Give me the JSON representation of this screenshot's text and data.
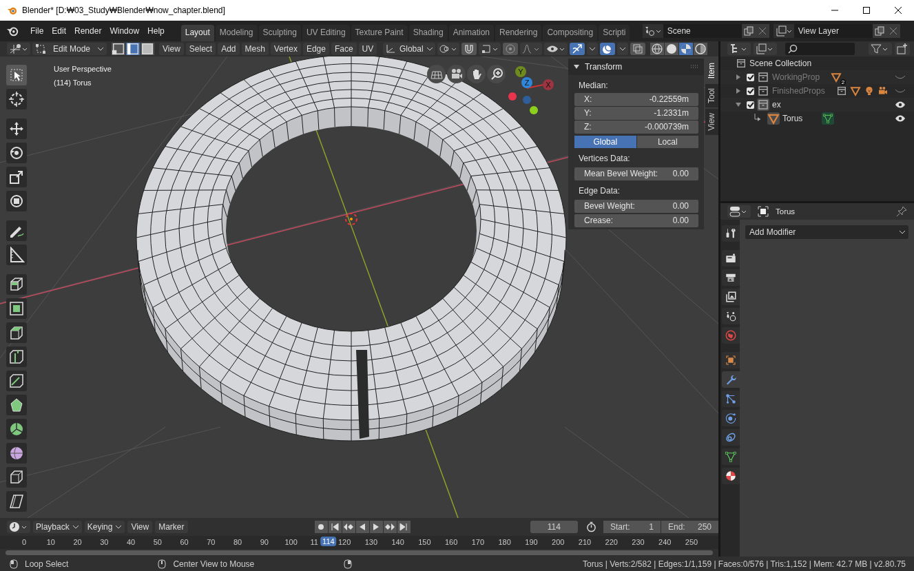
{
  "title_bar": {
    "title": "Blender* [D:₩03_Study₩Blender₩now_chapter.blend]"
  },
  "menu": [
    "File",
    "Edit",
    "Render",
    "Window",
    "Help"
  ],
  "workspace_tabs": [
    {
      "label": "Layout",
      "selected": true
    },
    {
      "label": "Modeling",
      "selected": false
    },
    {
      "label": "Sculpting",
      "selected": false
    },
    {
      "label": "UV Editing",
      "selected": false
    },
    {
      "label": "Texture Paint",
      "selected": false
    },
    {
      "label": "Shading",
      "selected": false
    },
    {
      "label": "Animation",
      "selected": false
    },
    {
      "label": "Rendering",
      "selected": false
    },
    {
      "label": "Compositing",
      "selected": false
    },
    {
      "label": "Scripti",
      "selected": false
    }
  ],
  "scene": {
    "name": "Scene"
  },
  "view_layer": {
    "name": "View Layer"
  },
  "viewport_header": {
    "mode": "Edit Mode",
    "select_modes": [
      {
        "kind": "vertex",
        "selected": false
      },
      {
        "kind": "edge",
        "selected": true
      },
      {
        "kind": "face",
        "selected": false
      }
    ],
    "menus": [
      "View",
      "Select",
      "Add",
      "Mesh",
      "Vertex",
      "Edge",
      "Face",
      "UV"
    ],
    "orientation": "Global",
    "snap": false,
    "proportional": false,
    "gizmos": true,
    "overlays": true,
    "xray": false,
    "shading": [
      {
        "kind": "wireframe",
        "selected": false
      },
      {
        "kind": "solid",
        "selected": false
      },
      {
        "kind": "material",
        "selected": true
      },
      {
        "kind": "rendered",
        "selected": false
      }
    ]
  },
  "viewport": {
    "view_name": "User Perspective",
    "object_info": "(114) Torus",
    "gizmo_axes": [
      {
        "label": "Y",
        "color": "#6f8a1f"
      },
      {
        "label": "Z",
        "color": "#2f86d8"
      },
      {
        "label": "X",
        "color": "#9c3441"
      }
    ]
  },
  "toolbar": [
    {
      "kind": "select",
      "selected": true
    },
    {
      "kind": "cursor",
      "selected": false
    },
    {
      "kind": "move",
      "selected": false
    },
    {
      "kind": "rotate",
      "selected": false
    },
    {
      "kind": "scale",
      "selected": false
    },
    {
      "kind": "transform",
      "selected": false
    },
    {
      "kind": "annotate",
      "selected": false
    },
    {
      "kind": "measure",
      "selected": false
    },
    {
      "kind": "extrude",
      "selected": false
    },
    {
      "kind": "inset",
      "selected": false
    },
    {
      "kind": "bevel",
      "selected": false
    },
    {
      "kind": "loopcut",
      "selected": false
    },
    {
      "kind": "knife",
      "selected": false
    },
    {
      "kind": "polybuild",
      "selected": false
    },
    {
      "kind": "spin",
      "selected": false
    },
    {
      "kind": "smooth",
      "selected": false
    },
    {
      "kind": "shrink",
      "selected": false
    },
    {
      "kind": "shear",
      "selected": false
    }
  ],
  "sidebar": {
    "tabs": [
      {
        "label": "Item",
        "selected": true
      },
      {
        "label": "Tool",
        "selected": false
      },
      {
        "label": "View",
        "selected": false
      }
    ],
    "transform": {
      "title": "Transform",
      "expanded": true,
      "median_label": "Median:",
      "fields": [
        {
          "label": "X:",
          "value": "-0.22559m"
        },
        {
          "label": "Y:",
          "value": "-1.2331m"
        },
        {
          "label": "Z:",
          "value": "-0.000739m"
        }
      ],
      "space": [
        {
          "label": "Global",
          "selected": true
        },
        {
          "label": "Local",
          "selected": false
        }
      ],
      "vertices_label": "Vertices Data:",
      "vertex_fields": [
        {
          "label": "Mean Bevel Weight:",
          "value": "0.00"
        }
      ],
      "edge_label": "Edge Data:",
      "edge_fields": [
        {
          "label": "Bevel Weight:",
          "value": "0.00"
        },
        {
          "label": "Crease:",
          "value": "0.00"
        }
      ]
    }
  },
  "outliner": {
    "root": "Scene Collection",
    "items": [
      {
        "label": "WorkingProp",
        "expanded": false,
        "checked": true,
        "visible": false,
        "contents": [
          {
            "kind": "mesh",
            "count": "2"
          }
        ]
      },
      {
        "label": "FinishedProps",
        "expanded": false,
        "checked": true,
        "visible": false,
        "contents": [
          {
            "kind": "collection"
          },
          {
            "kind": "mesh"
          },
          {
            "kind": "light"
          },
          {
            "kind": "camera"
          }
        ]
      },
      {
        "label": "ex",
        "expanded": true,
        "checked": true,
        "visible": true,
        "children": [
          {
            "label": "Torus",
            "visible": true
          }
        ]
      }
    ]
  },
  "properties": {
    "object_name": "Torus",
    "tabs": [
      {
        "kind": "tool",
        "selected": false
      },
      {
        "kind": "render",
        "selected": false
      },
      {
        "kind": "output",
        "selected": false
      },
      {
        "kind": "view_layer",
        "selected": false
      },
      {
        "kind": "scene",
        "selected": false
      },
      {
        "kind": "world",
        "selected": false
      },
      {
        "kind": "object",
        "selected": false
      },
      {
        "kind": "modifier",
        "selected": true
      },
      {
        "kind": "particles",
        "selected": false
      },
      {
        "kind": "physics",
        "selected": false
      },
      {
        "kind": "constraints",
        "selected": false
      },
      {
        "kind": "data",
        "selected": false
      },
      {
        "kind": "material",
        "selected": false
      }
    ],
    "add_modifier": "Add Modifier"
  },
  "timeline": {
    "menus": [
      "Playback",
      "Keying",
      "View",
      "Marker"
    ],
    "current_frame": "114",
    "start_label": "Start:",
    "start": "1",
    "end_label": "End:",
    "end": "250",
    "ticks": [
      "0",
      "10",
      "20",
      "30",
      "40",
      "50",
      "60",
      "70",
      "80",
      "90",
      "100",
      "11",
      "120",
      "130",
      "140",
      "150",
      "160",
      "170",
      "180",
      "190",
      "200",
      "210",
      "220",
      "230",
      "240",
      "250"
    ],
    "playhead": {
      "label": "114",
      "level": 0.456
    }
  },
  "status_bar": {
    "hints": [
      {
        "kind": "mouse-left",
        "label": "Loop Select"
      },
      {
        "kind": "mouse-middle",
        "label": "Center View to Mouse"
      },
      {
        "kind": "mouse-right"
      }
    ],
    "stats": "Torus | Verts:2/582 | Edges:1/1,159 | Faces:0/576 | Tris:1,152 | Mem: 42.7 MB | v2.80.75"
  }
}
